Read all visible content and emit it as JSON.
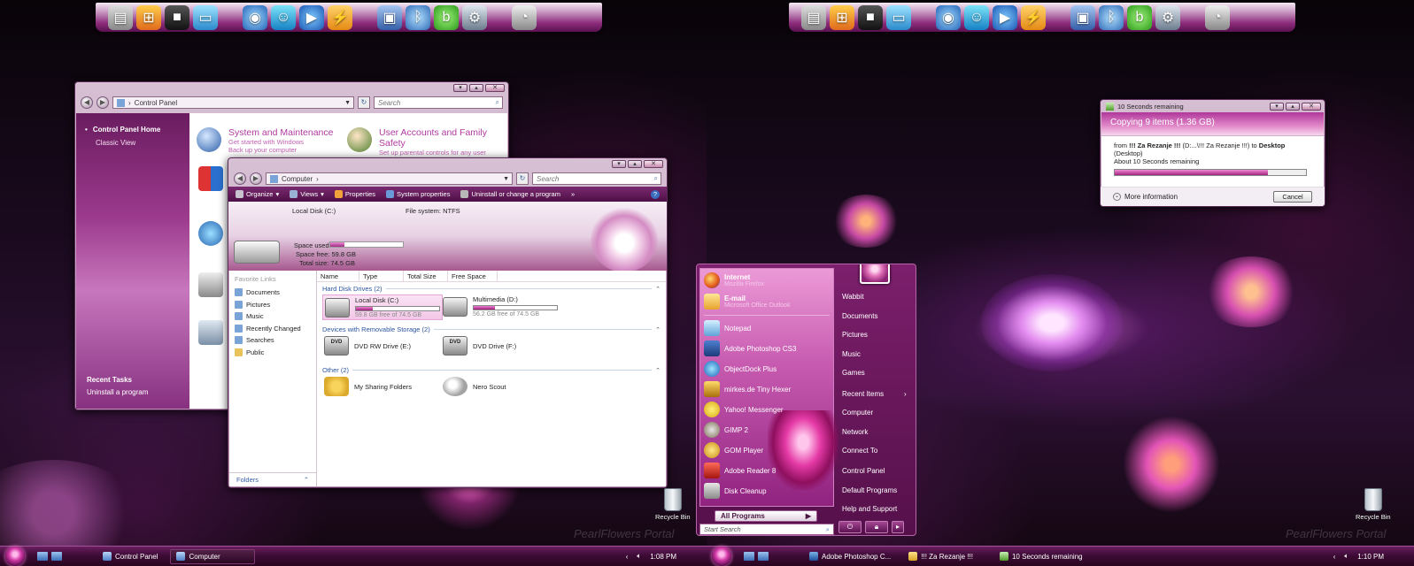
{
  "left_screen": {
    "control_panel": {
      "address": "Control Panel",
      "search_placeholder": "Search",
      "sidebar": {
        "home": "Control Panel Home",
        "classic": "Classic View",
        "tasks_title": "Recent Tasks",
        "task_1": "Uninstall a program"
      },
      "categories": [
        {
          "title": "System and Maintenance",
          "sub1": "Get started with Windows",
          "sub2": "Back up your computer"
        },
        {
          "title": "User Accounts and Family Safety",
          "sub1": "Set up parental controls for any user",
          "sub2": ""
        }
      ]
    },
    "computer": {
      "address": "Computer",
      "search_placeholder": "Search",
      "toolbar": {
        "organize": "Organize",
        "views": "Views",
        "properties": "Properties",
        "system_properties": "System properties",
        "uninstall": "Uninstall or change a program"
      },
      "details": {
        "name": "Local Disk (C:)",
        "filesystem": "File system: NTFS",
        "space_used_label": "Space used:",
        "space_free": "Space free: 59.8 GB",
        "total_size": "Total size: 74.5 GB",
        "space_used_fraction": 0.2
      },
      "favorite_links": {
        "title": "Favorite Links",
        "items": [
          "Documents",
          "Pictures",
          "Music",
          "Recently Changed",
          "Searches",
          "Public"
        ]
      },
      "folders_label": "Folders",
      "columns": [
        "Name",
        "Type",
        "Total Size",
        "Free Space"
      ],
      "groups": {
        "hard_disks": "Hard Disk Drives (2)",
        "removable": "Devices with Removable Storage (2)",
        "other": "Other (2)"
      },
      "drives": [
        {
          "name": "Local Disk (C:)",
          "free": "59.8 GB free of 74.5 GB",
          "used_fraction": 0.2
        },
        {
          "name": "Multimedia (D:)",
          "free": "56.2 GB free of 74.5 GB",
          "used_fraction": 0.25
        }
      ],
      "removable": [
        "DVD RW Drive (E:)",
        "DVD Drive (F:)"
      ],
      "other": [
        "My Sharing Folders",
        "Nero Scout"
      ]
    },
    "recycle_bin": "Recycle Bin",
    "watermark": "PearlFlowers Portal",
    "taskbar": {
      "btn_1": "Control Panel",
      "btn_2": "Computer",
      "time": "1:08 PM"
    }
  },
  "right_screen": {
    "start_menu": {
      "pinned": [
        {
          "name": "Internet",
          "sub": "Mozilla Firefox"
        },
        {
          "name": "E-mail",
          "sub": "Microsoft Office Outlook"
        }
      ],
      "recent": [
        "Notepad",
        "Adobe Photoshop CS3",
        "ObjectDock Plus",
        "mirkes.de Tiny Hexer",
        "Yahoo! Messenger",
        "GIMP 2",
        "GOM Player",
        "Adobe Reader 8",
        "Disk Cleanup"
      ],
      "all_programs": "All Programs",
      "search_placeholder": "Start Search",
      "right_items": [
        "Wabbit",
        "Documents",
        "Pictures",
        "Music",
        "Games",
        "Recent Items",
        "Computer",
        "Network",
        "Connect To",
        "Control Panel",
        "Default Programs",
        "Help and Support"
      ]
    },
    "copy_dialog": {
      "title": "10 Seconds remaining",
      "heading": "Copying 9 items (1.36 GB)",
      "from_line_a": "from ",
      "from_bold": "!!! Za Rezanje !!!",
      "from_line_b": " (D:...\\!!! Za Rezanje !!!)  to ",
      "to_bold": "Desktop",
      "to_suffix": " (Desktop)",
      "remaining": "About 10 Seconds remaining",
      "progress_fraction": 0.8,
      "more_info": "More information",
      "cancel": "Cancel"
    },
    "recycle_bin": "Recycle Bin",
    "watermark": "PearlFlowers Portal",
    "taskbar": {
      "btn_1": "Adobe Photoshop C...",
      "btn_2": "!!! Za Rezanje !!!",
      "btn_3": "10 Seconds remaining",
      "time": "1:10 PM"
    }
  },
  "colors": {
    "accent": "#a0267f",
    "title_pink": "#b03aa0",
    "link_blue": "#2a55a0"
  }
}
